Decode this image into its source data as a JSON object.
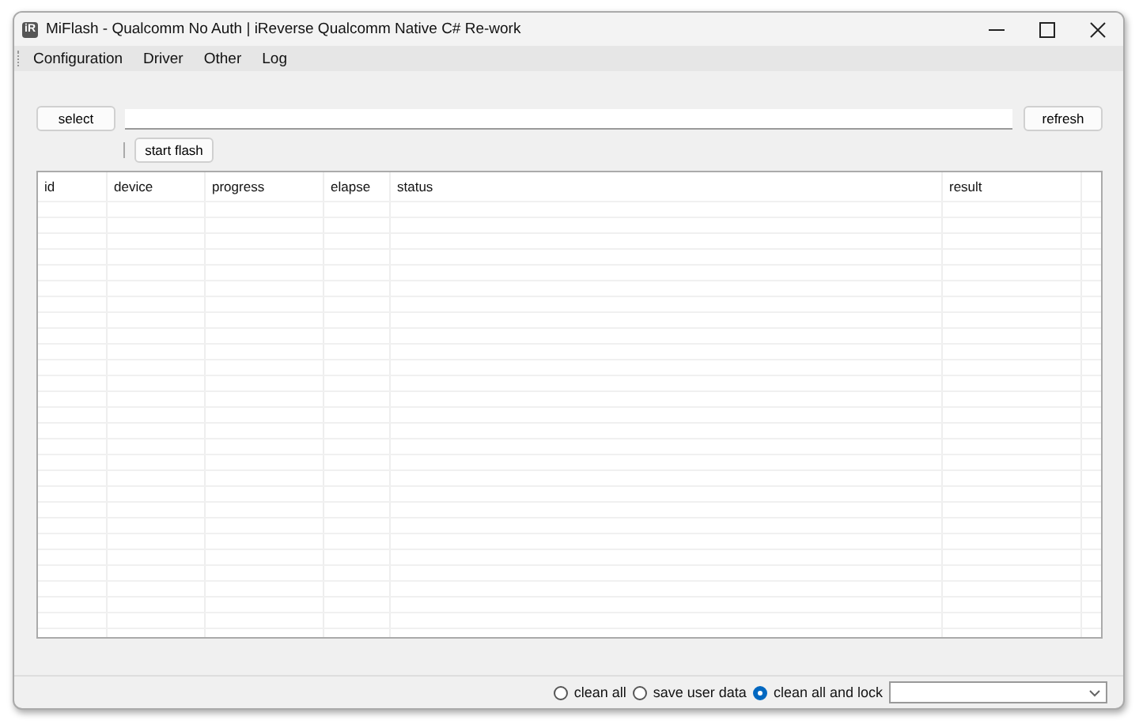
{
  "window": {
    "title": "MiFlash - Qualcomm No Auth | iReverse Qualcomm Native C# Re-work",
    "app_icon": "iR"
  },
  "menu": [
    "Configuration",
    "Driver",
    "Other",
    "Log"
  ],
  "toolbar": {
    "select_button": "select",
    "refresh_button": "refresh",
    "start_button": "start flash"
  },
  "table": {
    "columns": [
      "id",
      "device",
      "progress",
      "elapse",
      "status",
      "result"
    ]
  },
  "status_bar": {
    "options": [
      {
        "label": "clean all",
        "selected": false
      },
      {
        "label": "save user data",
        "selected": false
      },
      {
        "label": "clean all and lock",
        "selected": true
      }
    ]
  }
}
